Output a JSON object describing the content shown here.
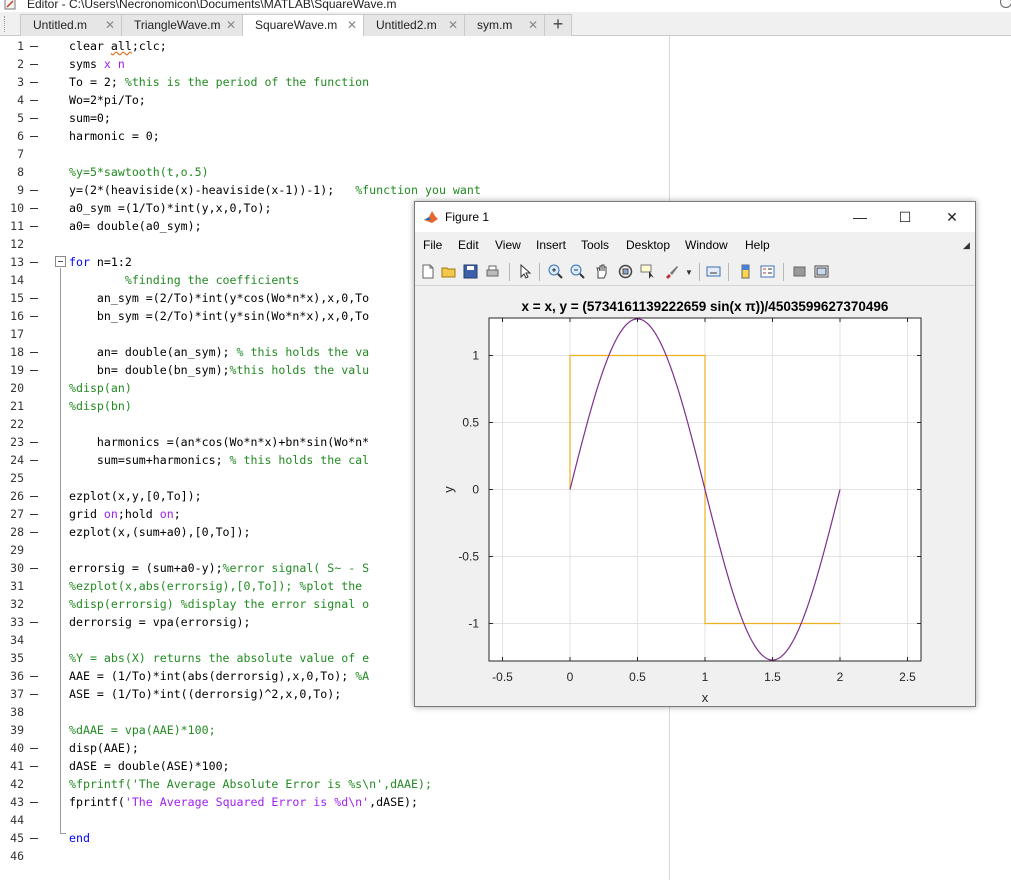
{
  "editor_title": "Editor - C:\\Users\\Necronomicon\\Documents\\MATLAB\\SquareWave.m",
  "tabs": [
    {
      "label": "Untitled.m",
      "active": false
    },
    {
      "label": "TriangleWave.m",
      "active": false
    },
    {
      "label": "SquareWave.m",
      "active": true
    },
    {
      "label": "Untitled2.m",
      "active": false
    },
    {
      "label": "sym.m",
      "active": false
    }
  ],
  "tab_close_glyph": "✕",
  "tab_add_glyph": "+",
  "icons": {
    "app": "matlab-editor-icon",
    "help": "help-icon",
    "fold": "code-fold-icon"
  },
  "code_lines": [
    {
      "n": "1",
      "dash": true,
      "segs": [
        [
          "",
          "clear "
        ],
        [
          "sq",
          "all"
        ],
        [
          "",
          ";clc;"
        ]
      ]
    },
    {
      "n": "2",
      "dash": true,
      "segs": [
        [
          "",
          "syms "
        ],
        [
          "st",
          "x n"
        ]
      ]
    },
    {
      "n": "3",
      "dash": true,
      "segs": [
        [
          "",
          "To = 2; "
        ],
        [
          "cm",
          "%this is the period of the function"
        ]
      ]
    },
    {
      "n": "4",
      "dash": true,
      "segs": [
        [
          "",
          "Wo=2*pi/To;"
        ]
      ]
    },
    {
      "n": "5",
      "dash": true,
      "segs": [
        [
          "",
          "sum=0;"
        ]
      ]
    },
    {
      "n": "6",
      "dash": true,
      "segs": [
        [
          "",
          "harmonic = 0;"
        ]
      ]
    },
    {
      "n": "7",
      "dash": false,
      "segs": []
    },
    {
      "n": "8",
      "dash": false,
      "segs": [
        [
          "cm",
          "%y=5*sawtooth(t,o.5)"
        ]
      ]
    },
    {
      "n": "9",
      "dash": true,
      "segs": [
        [
          "",
          "y=(2*(heaviside(x)-heaviside(x-1))-1);   "
        ],
        [
          "cm",
          "%function you want"
        ]
      ]
    },
    {
      "n": "10",
      "dash": true,
      "segs": [
        [
          "",
          "a0_sym =(1/To)*int(y,x,0,To);"
        ]
      ]
    },
    {
      "n": "11",
      "dash": true,
      "segs": [
        [
          "",
          "a0= double(a0_sym);"
        ]
      ]
    },
    {
      "n": "12",
      "dash": false,
      "segs": []
    },
    {
      "n": "13",
      "dash": true,
      "segs": [
        [
          "kw",
          "for"
        ],
        [
          "",
          " n=1:2"
        ]
      ]
    },
    {
      "n": "14",
      "dash": false,
      "segs": [
        [
          "cm",
          "        %finding the coefficients"
        ]
      ]
    },
    {
      "n": "15",
      "dash": true,
      "segs": [
        [
          "",
          "    an_sym =(2/To)*int(y*cos(Wo*n*x),x,0,To"
        ]
      ]
    },
    {
      "n": "16",
      "dash": true,
      "segs": [
        [
          "",
          "    bn_sym =(2/To)*int(y*sin(Wo*n*x),x,0,To"
        ]
      ]
    },
    {
      "n": "17",
      "dash": false,
      "segs": []
    },
    {
      "n": "18",
      "dash": true,
      "segs": [
        [
          "",
          "    an= double(an_sym); "
        ],
        [
          "cm",
          "% this holds the va"
        ]
      ]
    },
    {
      "n": "19",
      "dash": true,
      "segs": [
        [
          "",
          "    bn= double(bn_sym);"
        ],
        [
          "cm",
          "%this holds the valu"
        ]
      ]
    },
    {
      "n": "20",
      "dash": false,
      "segs": [
        [
          "cm",
          "%disp(an)"
        ]
      ]
    },
    {
      "n": "21",
      "dash": false,
      "segs": [
        [
          "cm",
          "%disp(bn)"
        ]
      ]
    },
    {
      "n": "22",
      "dash": false,
      "segs": []
    },
    {
      "n": "23",
      "dash": true,
      "segs": [
        [
          "",
          "    harmonics =(an*cos(Wo*n*x)+bn*sin(Wo*n*"
        ]
      ]
    },
    {
      "n": "24",
      "dash": true,
      "segs": [
        [
          "",
          "    sum=sum+harmonics; "
        ],
        [
          "cm",
          "% this holds the cal"
        ]
      ]
    },
    {
      "n": "25",
      "dash": false,
      "segs": []
    },
    {
      "n": "26",
      "dash": true,
      "segs": [
        [
          "",
          "ezplot(x,y,[0,To]);"
        ]
      ]
    },
    {
      "n": "27",
      "dash": true,
      "segs": [
        [
          "",
          "grid "
        ],
        [
          "st",
          "on"
        ],
        [
          "",
          ";hold "
        ],
        [
          "st",
          "on"
        ],
        [
          "",
          ";"
        ]
      ]
    },
    {
      "n": "28",
      "dash": true,
      "segs": [
        [
          "",
          "ezplot(x,(sum+a0),[0,To]);"
        ]
      ]
    },
    {
      "n": "29",
      "dash": false,
      "segs": []
    },
    {
      "n": "30",
      "dash": true,
      "segs": [
        [
          "",
          "errorsig = (sum+a0-y);"
        ],
        [
          "cm",
          "%error signal( S~ - S"
        ]
      ]
    },
    {
      "n": "31",
      "dash": false,
      "segs": [
        [
          "cm",
          "%ezplot(x,abs(errorsig),[0,To]); %plot the "
        ]
      ]
    },
    {
      "n": "32",
      "dash": false,
      "segs": [
        [
          "cm",
          "%disp(errorsig) %display the error signal o"
        ]
      ]
    },
    {
      "n": "33",
      "dash": true,
      "segs": [
        [
          "",
          "derrorsig = vpa(errorsig);"
        ]
      ]
    },
    {
      "n": "34",
      "dash": false,
      "segs": []
    },
    {
      "n": "35",
      "dash": false,
      "segs": [
        [
          "cm",
          "%Y = abs(X) returns the absolute value of e"
        ]
      ]
    },
    {
      "n": "36",
      "dash": true,
      "segs": [
        [
          "",
          "AAE = (1/To)*int(abs(derrorsig),x,0,To); "
        ],
        [
          "cm",
          "%A"
        ]
      ]
    },
    {
      "n": "37",
      "dash": true,
      "segs": [
        [
          "",
          "ASE = (1/To)*int((derrorsig)^2,x,0,To);"
        ]
      ]
    },
    {
      "n": "38",
      "dash": false,
      "segs": []
    },
    {
      "n": "39",
      "dash": false,
      "segs": [
        [
          "cm",
          "%dAAE = vpa(AAE)*100;"
        ]
      ]
    },
    {
      "n": "40",
      "dash": true,
      "segs": [
        [
          "",
          "disp(AAE);"
        ]
      ]
    },
    {
      "n": "41",
      "dash": true,
      "segs": [
        [
          "",
          "dASE = double(ASE)*100;"
        ]
      ]
    },
    {
      "n": "42",
      "dash": false,
      "segs": [
        [
          "cm",
          "%fprintf('The Average Absolute Error is %s\\n',dAAE);"
        ]
      ]
    },
    {
      "n": "43",
      "dash": true,
      "segs": [
        [
          "",
          "fprintf("
        ],
        [
          "st",
          "'The Average Squared Error is %d\\n'"
        ],
        [
          "",
          ",dASE);"
        ]
      ]
    },
    {
      "n": "44",
      "dash": false,
      "segs": []
    },
    {
      "n": "45",
      "dash": true,
      "segs": [
        [
          "kw",
          "end"
        ]
      ]
    },
    {
      "n": "46",
      "dash": false,
      "segs": []
    }
  ],
  "figure": {
    "title": "Figure 1",
    "window_buttons": {
      "minimize": "—",
      "maximize": "☐",
      "close": "✕"
    },
    "menu": [
      "File",
      "Edit",
      "View",
      "Insert",
      "Tools",
      "Desktop",
      "Window",
      "Help"
    ],
    "menu_arrow": "◢",
    "toolbar_icons": [
      "new-figure-icon",
      "open-file-icon",
      "save-icon",
      "print-icon",
      "edit-plot-icon",
      "zoom-in-icon",
      "zoom-out-icon",
      "pan-icon",
      "rotate-3d-icon",
      "data-cursor-icon",
      "brush-icon",
      "link-plot-icon",
      "insert-colorbar-icon",
      "insert-legend-icon",
      "hide-plot-tools-icon",
      "show-plot-tools-icon"
    ]
  },
  "chart_data": {
    "type": "line",
    "title": "x = x, y = (5734161139222659 sin(x π))/4503599627370496",
    "xlabel": "x",
    "ylabel": "y",
    "xlim": [
      -0.6,
      2.6
    ],
    "ylim": [
      -1.28,
      1.28
    ],
    "xticks": [
      -0.5,
      0,
      0.5,
      1,
      1.5,
      2,
      2.5
    ],
    "xtick_labels": [
      "-0.5",
      "0",
      "0.5",
      "1",
      "1.5",
      "2",
      "2.5"
    ],
    "yticks": [
      -1,
      -0.5,
      0,
      0.5,
      1
    ],
    "ytick_labels": [
      "-1",
      "-0.5",
      "0",
      "0.5",
      "1"
    ],
    "grid": true,
    "series": [
      {
        "color": "#EDB120",
        "x": [
          0,
          0,
          1,
          1,
          2
        ],
        "y": [
          0,
          1,
          1,
          -1,
          -1
        ]
      },
      {
        "color": "#7E2F8E",
        "function": "1.2732 sin(pi x)",
        "amplitude": 1.2732,
        "x_range": [
          0,
          2
        ]
      }
    ]
  }
}
